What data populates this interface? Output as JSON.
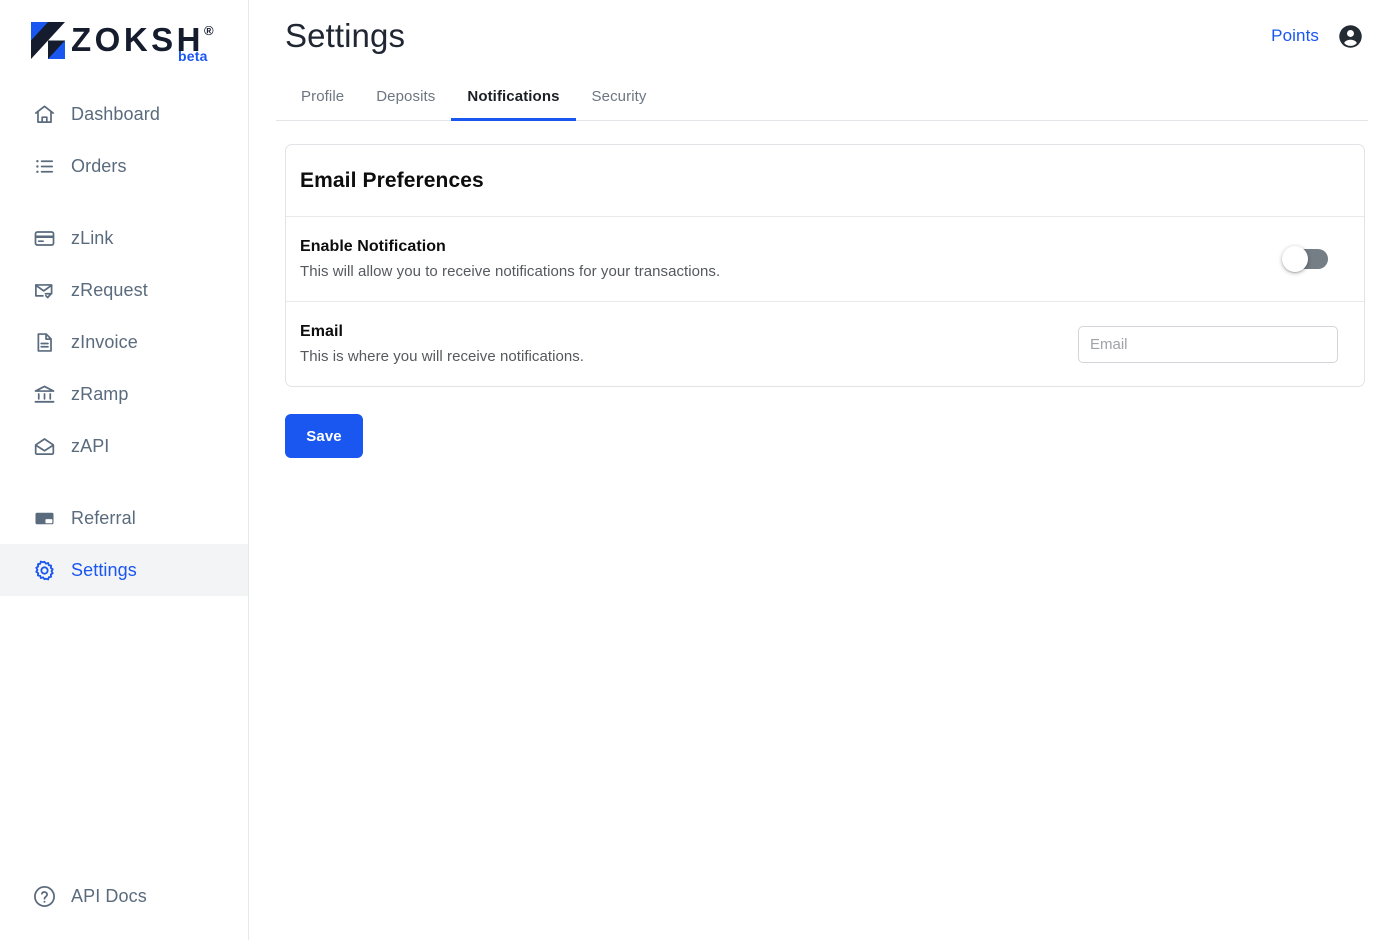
{
  "brand": {
    "mark_icon": "zoksh-logo-mark",
    "name": "ZOKSH",
    "registered_symbol": "®",
    "beta_label": "beta",
    "colors": {
      "blue": "#1a56f0",
      "navy": "#141c2e"
    }
  },
  "sidebar": {
    "groups": [
      {
        "items": [
          {
            "label": "Dashboard",
            "icon": "home-icon",
            "key": "dashboard",
            "active": false
          },
          {
            "label": "Orders",
            "icon": "list-icon",
            "key": "orders",
            "active": false
          }
        ]
      },
      {
        "items": [
          {
            "label": "zLink",
            "icon": "credit-card-icon",
            "key": "zlink",
            "active": false
          },
          {
            "label": "zRequest",
            "icon": "mail-check-icon",
            "key": "zrequest",
            "active": false
          },
          {
            "label": "zInvoice",
            "icon": "document-icon",
            "key": "zinvoice",
            "active": false
          },
          {
            "label": "zRamp",
            "icon": "bank-icon",
            "key": "zramp",
            "active": false
          },
          {
            "label": "zAPI",
            "icon": "open-envelope-icon",
            "key": "zapi",
            "active": false
          }
        ]
      },
      {
        "items": [
          {
            "label": "Referral",
            "icon": "referral-icon",
            "key": "referral",
            "active": false
          },
          {
            "label": "Settings",
            "icon": "gear-icon",
            "key": "settings",
            "active": true
          }
        ]
      }
    ],
    "bottom": {
      "label": "API Docs",
      "icon": "help-circle-icon",
      "key": "api-docs"
    }
  },
  "header": {
    "title": "Settings",
    "points_label": "Points",
    "avatar_icon": "account-circle-icon"
  },
  "tabs": [
    {
      "label": "Profile",
      "active": false
    },
    {
      "label": "Deposits",
      "active": false
    },
    {
      "label": "Notifications",
      "active": true
    },
    {
      "label": "Security",
      "active": false
    }
  ],
  "card": {
    "title": "Email Preferences",
    "rows": [
      {
        "label": "Enable Notification",
        "description": "This will allow you to receive notifications for your transactions.",
        "control": "toggle",
        "toggle_state": "off"
      },
      {
        "label": "Email",
        "description": "This is where you will receive notifications.",
        "control": "input",
        "input_value": "",
        "input_placeholder": "Email"
      }
    ]
  },
  "actions": {
    "save_label": "Save"
  }
}
